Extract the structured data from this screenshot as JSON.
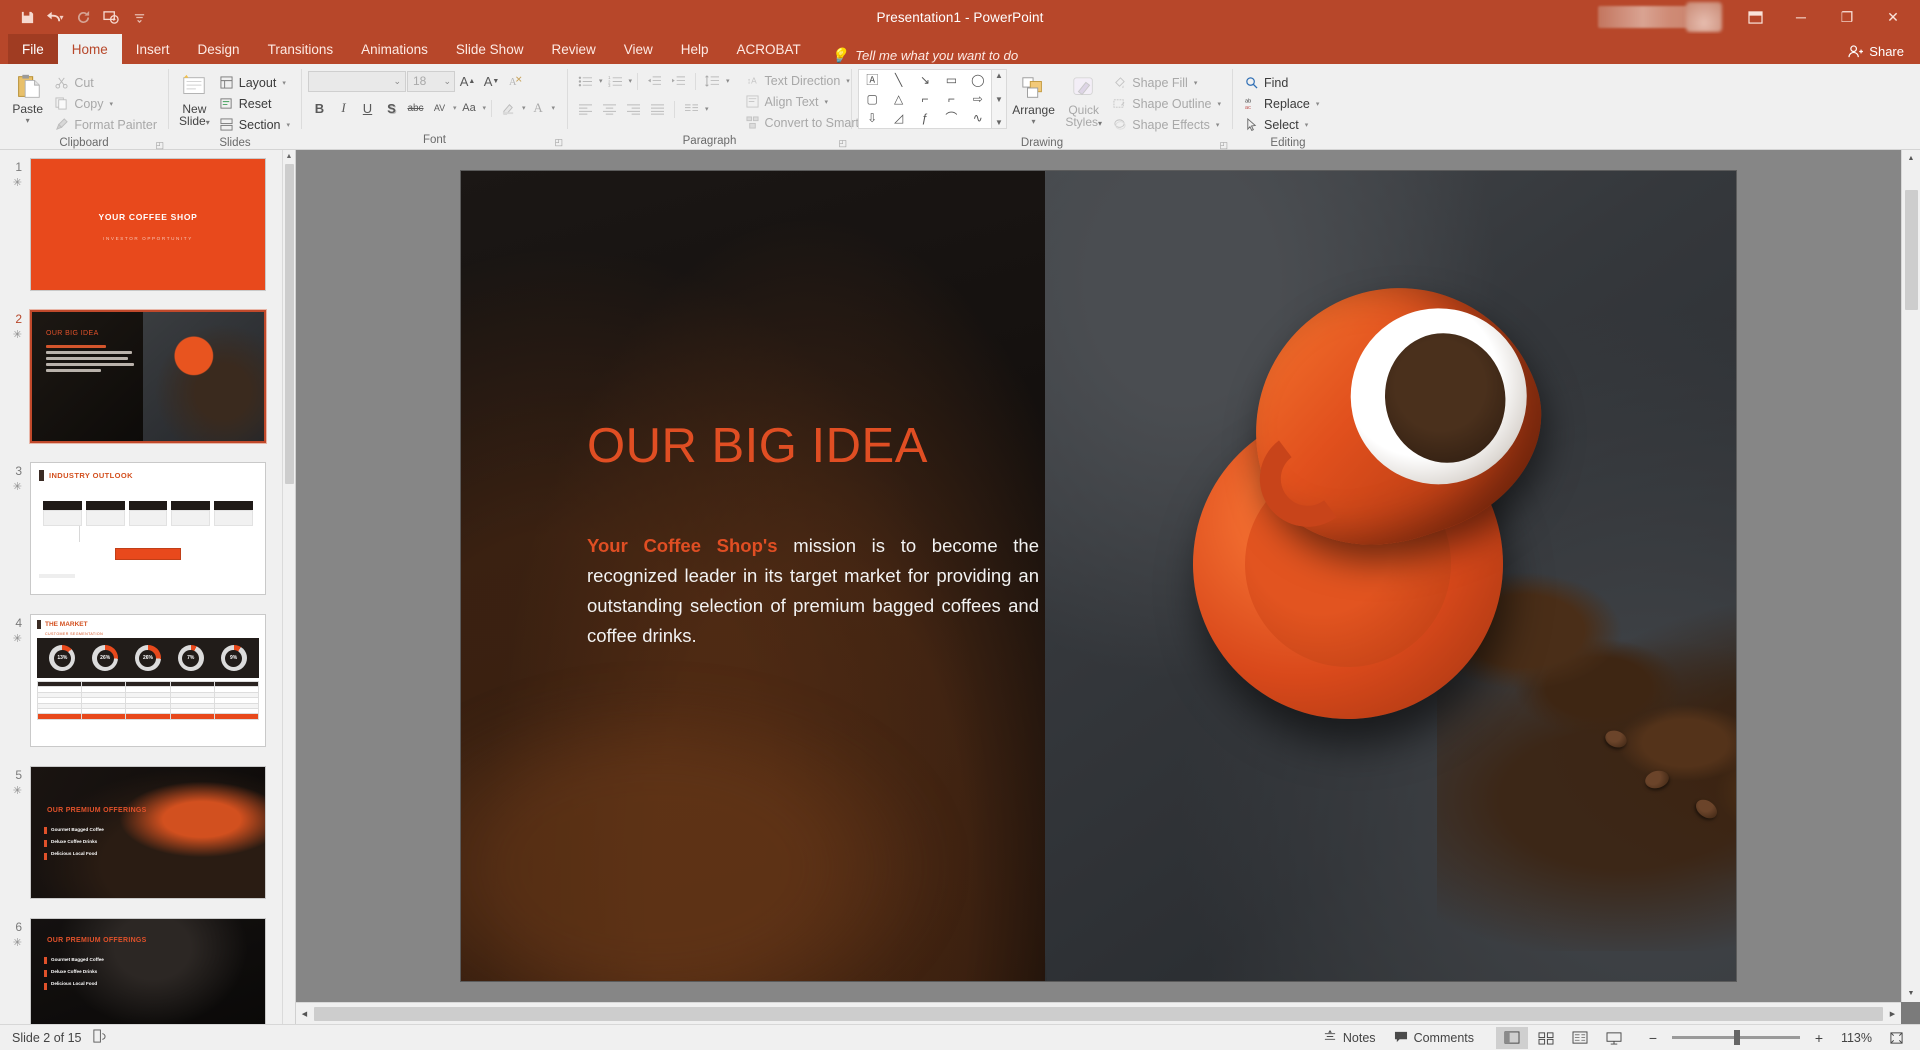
{
  "titlebar": {
    "app_title": "Presentation1  -  PowerPoint",
    "qat": [
      {
        "name": "save",
        "glyph": "💾"
      },
      {
        "name": "undo",
        "glyph": "↶"
      },
      {
        "name": "redo",
        "glyph": "↷"
      },
      {
        "name": "start-from-beginning",
        "glyph": "⧉"
      },
      {
        "name": "customize-quick-access-toolbar",
        "glyph": "▾"
      }
    ],
    "window": {
      "minimize": "─",
      "restore": "❐",
      "close": "✕",
      "ribbon_options": "⬒"
    },
    "share_label": "Share"
  },
  "tabs": [
    {
      "label": "File",
      "kind": "file"
    },
    {
      "label": "Home",
      "kind": "active"
    },
    {
      "label": "Insert",
      "kind": "normal"
    },
    {
      "label": "Design",
      "kind": "normal"
    },
    {
      "label": "Transitions",
      "kind": "normal"
    },
    {
      "label": "Animations",
      "kind": "normal"
    },
    {
      "label": "Slide Show",
      "kind": "normal"
    },
    {
      "label": "Review",
      "kind": "normal"
    },
    {
      "label": "View",
      "kind": "normal"
    },
    {
      "label": "Help",
      "kind": "normal"
    },
    {
      "label": "ACROBAT",
      "kind": "normal"
    }
  ],
  "tellme": {
    "label": "Tell me what you want to do",
    "icon": "lightbulb-icon"
  },
  "ribbon": {
    "groups": [
      "Clipboard",
      "Slides",
      "Font",
      "Paragraph",
      "Drawing",
      "Editing"
    ],
    "clipboard": {
      "paste": "Paste",
      "cut": "Cut",
      "copy": "Copy",
      "format_painter": "Format Painter"
    },
    "slides": {
      "new_slide_line1": "New",
      "new_slide_line2": "Slide",
      "layout": "Layout",
      "reset": "Reset",
      "section": "Section"
    },
    "font": {
      "font_name": "",
      "font_size": "18",
      "grow": "A",
      "shrink": "A",
      "clear_formatting": "✐",
      "bold": "B",
      "italic": "I",
      "underline": "U",
      "shadow": "S",
      "strikethrough": "abc",
      "character_spacing": "AV",
      "change_case": "Aa",
      "text_highlight": "✎",
      "font_color": "A"
    },
    "paragraph": {
      "text_direction": "Text Direction",
      "align_text": "Align Text",
      "convert_to_smartart": "Convert to SmartArt"
    },
    "drawing": {
      "arrange": "Arrange",
      "quick_styles_line1": "Quick",
      "quick_styles_line2": "Styles",
      "shape_fill": "Shape Fill",
      "shape_outline": "Shape Outline",
      "shape_effects": "Shape Effects",
      "shapes": [
        "A",
        "╲",
        "↘",
        "▭",
        "◯",
        "▢",
        "△",
        "⌐",
        "⌙",
        "⇨",
        "⇩",
        "⌐",
        "ƒ",
        "⌒",
        "∿",
        "{",
        "}",
        "☆"
      ]
    },
    "editing": {
      "find": "Find",
      "replace": "Replace",
      "select": "Select"
    }
  },
  "thumbnails": [
    {
      "number": "1",
      "title": "YOUR COFFEE SHOP",
      "subtitle": "INVESTOR OPPORTUNITY",
      "selected": false,
      "kind": "cover"
    },
    {
      "number": "2",
      "title": "OUR BIG IDEA",
      "selected": true,
      "kind": "bigidea"
    },
    {
      "number": "3",
      "title": "INDUSTRY OUTLOOK",
      "selected": false,
      "kind": "outlook"
    },
    {
      "number": "4",
      "title": "THE MARKET",
      "subtitle": "CUSTOMER SEGMENTATION",
      "selected": false,
      "kind": "market",
      "donuts": [
        "13%",
        "26%",
        "26%",
        "7%",
        "9%"
      ]
    },
    {
      "number": "5",
      "title": "OUR PREMIUM OFFERINGS",
      "selected": false,
      "kind": "offerings",
      "items": [
        "Gourmet Bagged Coffee",
        "Deluxe Coffee Drinks",
        "Delicious Local Food"
      ]
    },
    {
      "number": "6",
      "title": "OUR PREMIUM OFFERINGS",
      "selected": false,
      "kind": "offerings2",
      "items": [
        "Gourmet Bagged Coffee",
        "Deluxe Coffee Drinks",
        "Delicious Local Food"
      ]
    }
  ],
  "slide": {
    "title": "OUR BIG IDEA",
    "body_highlight": "Your Coffee Shop's",
    "body_rest": " mission is to become the recognized leader in its target market for providing an outstanding selection of premium bagged coffees and coffee drinks."
  },
  "status": {
    "slide_counter": "Slide 2 of 15",
    "accessibility_icon": "accessibility-checker-icon",
    "notes": "Notes",
    "comments": "Comments",
    "views": [
      {
        "name": "normal-view",
        "glyph": "▤",
        "active": true
      },
      {
        "name": "slide-sorter-view",
        "glyph": "☷",
        "active": false
      },
      {
        "name": "reading-view",
        "glyph": "▥",
        "active": false
      },
      {
        "name": "slide-show-view",
        "glyph": "⬜",
        "active": false
      }
    ],
    "zoom_out": "−",
    "zoom_in": "+",
    "zoom_value": "113%",
    "fit_to_window": "⛶"
  },
  "colors": {
    "brand": "#b7472a",
    "accent_orange": "#e0512a",
    "slide_bg": "#121010"
  }
}
